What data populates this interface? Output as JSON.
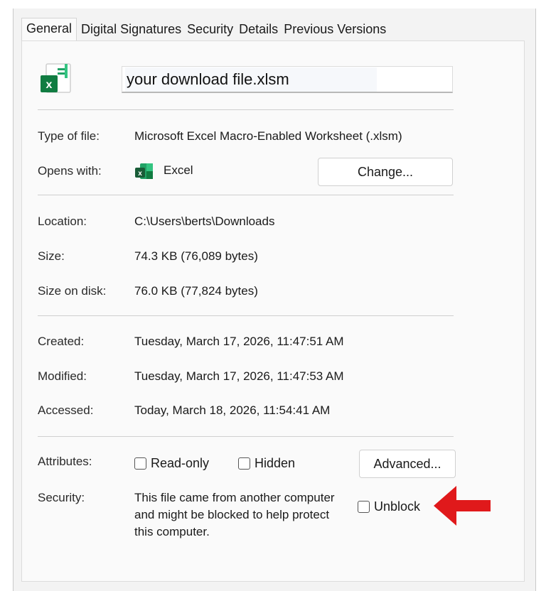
{
  "tabs": [
    {
      "label": "General",
      "active": true
    },
    {
      "label": "Digital Signatures"
    },
    {
      "label": "Security"
    },
    {
      "label": "Details"
    },
    {
      "label": "Previous Versions"
    }
  ],
  "file": {
    "name": "your download file.xlsm",
    "icon": "excel-icon"
  },
  "info": {
    "type_label": "Type of file:",
    "type_value": "Microsoft Excel Macro-Enabled Worksheet (.xlsm)",
    "opens_label": "Opens with:",
    "opens_value": "Excel",
    "change_button": "Change...",
    "location_label": "Location:",
    "location_value": "C:\\Users\\berts\\Downloads",
    "size_label": "Size:",
    "size_value": "74.3 KB (76,089 bytes)",
    "disk_label": "Size on disk:",
    "disk_value": "76.0 KB (77,824 bytes)",
    "created_label": "Created:",
    "created_value": "Tuesday, March 17, 2026, 11:47:51 AM",
    "modified_label": "Modified:",
    "modified_value": "Tuesday, March 17, 2026, 11:47:53 AM",
    "accessed_label": "Accessed:",
    "accessed_value": "Today, March 18, 2026, 11:54:41 AM"
  },
  "attributes": {
    "label": "Attributes:",
    "readonly": "Read-only",
    "hidden": "Hidden",
    "advanced_button": "Advanced..."
  },
  "security": {
    "label": "Security:",
    "note": "This file came from another computer and might be blocked to help protect this computer.",
    "unblock": "Unblock"
  },
  "colors": {
    "excel_green": "#1d6f42",
    "arrow_red": "#e0191b"
  }
}
